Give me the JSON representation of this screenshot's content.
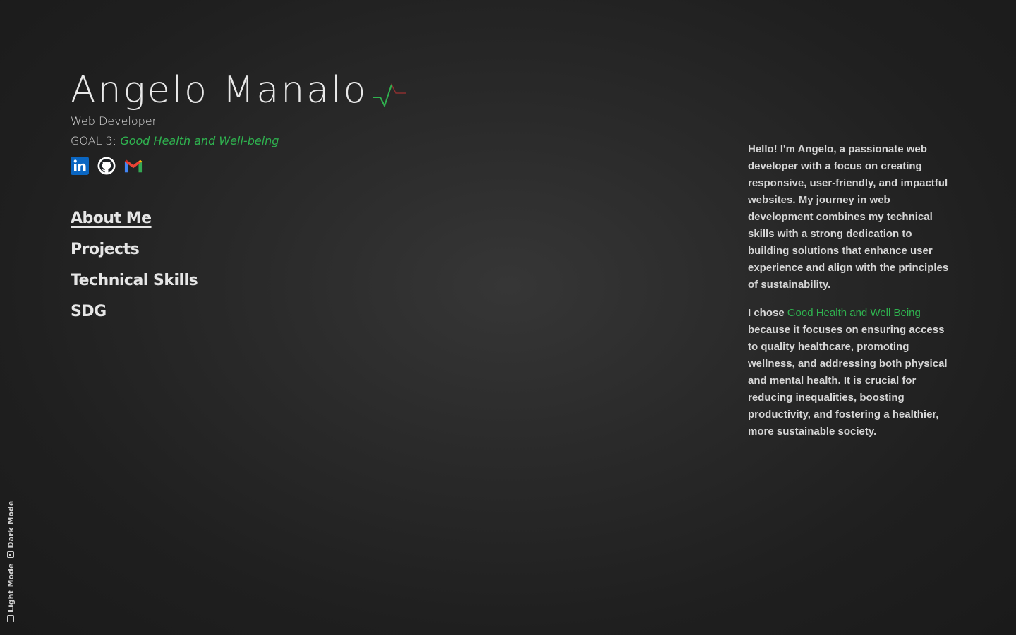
{
  "profile": {
    "name": "Angelo Manalo",
    "role": "Web Developer",
    "goal_prefix": "GOAL 3:",
    "goal_name": "Good Health and Well-being"
  },
  "socials": [
    {
      "name": "LinkedIn",
      "icon": "linkedin-icon"
    },
    {
      "name": "GitHub",
      "icon": "github-icon"
    },
    {
      "name": "Gmail",
      "icon": "gmail-icon"
    }
  ],
  "nav": {
    "items": [
      {
        "label": "About Me",
        "active": true
      },
      {
        "label": "Projects",
        "active": false
      },
      {
        "label": "Technical Skills",
        "active": false
      },
      {
        "label": "SDG",
        "active": false
      }
    ]
  },
  "about": {
    "paragraph1": "Hello! I'm Angelo, a passionate web developer with a focus on creating responsive, user-friendly, and impactful websites. My journey in web development combines my technical skills with a strong dedication to building solutions that enhance user experience and align with the principles of sustainability.",
    "paragraph2_prefix": "I chose ",
    "paragraph2_highlight": "Good Health and Well Being",
    "paragraph2_suffix": " because it focuses on ensuring access to quality healthcare, promoting wellness, and addressing both physical and mental health. It is crucial for reducing inequalities, boosting productivity, and fostering a healthier, more sustainable society."
  },
  "mode_toggle": {
    "light_label": "Light Mode",
    "dark_label": "Dark Mode",
    "selected": "Dark Mode"
  },
  "colors": {
    "accent_green": "#2fb24f",
    "pulse_red": "#b83a3a",
    "background": "#2a2a2a",
    "text": "#e6e6e6"
  }
}
